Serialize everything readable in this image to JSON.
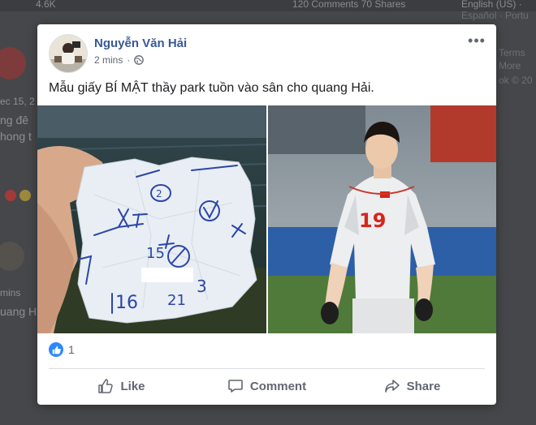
{
  "background": {
    "top_left_count": "4.6K",
    "top_stats": "120 Comments 70 Shares",
    "language_line1": "English (US) · ",
    "language_line2": "Español · Portu",
    "side_date": "ec 15, 2",
    "side_line1": "ng đê",
    "side_line2": "hong t",
    "side_time": "mins",
    "side_name": "uang H",
    "right_terms": "Terms",
    "right_more": "More",
    "right_book": "ok © 20"
  },
  "post": {
    "author": "Nguyễn Văn Hải",
    "timestamp": "2 mins",
    "separator": "·",
    "privacy_icon": "globe-icon",
    "more_icon": "ellipsis-icon",
    "more_label": "•••",
    "text": "Mẫu giấy BÍ MẬT thầy park tuồn vào sân cho quang Hải.",
    "photos": [
      {
        "description_icon": "crumpled-note-photo"
      },
      {
        "description_icon": "player-photo",
        "jersey_number": "19"
      }
    ],
    "reactions": {
      "icon": "like-icon",
      "count": "1"
    },
    "actions": [
      {
        "label": "Like",
        "icon": "thumbs-up-icon"
      },
      {
        "label": "Comment",
        "icon": "comment-icon"
      },
      {
        "label": "Share",
        "icon": "share-icon"
      }
    ]
  },
  "colors": {
    "author": "#385898",
    "like_blue": "#2d88ff",
    "muted": "#606770"
  }
}
